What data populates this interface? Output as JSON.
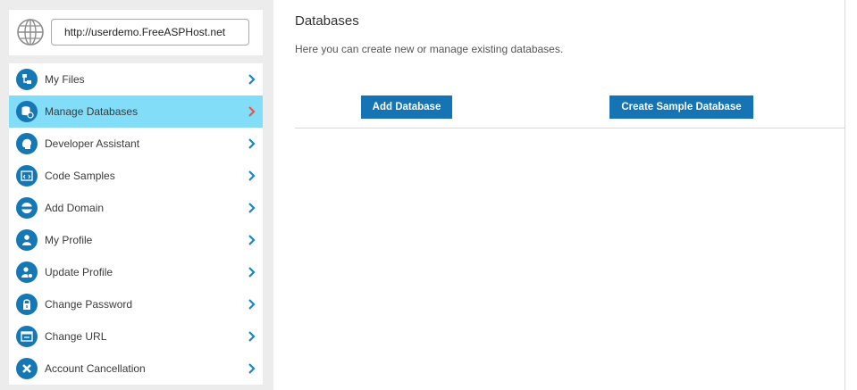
{
  "url": "http://userdemo.FreeASPHost.net",
  "menu": [
    {
      "label": "My Files",
      "icon": "files-icon"
    },
    {
      "label": "Manage Databases",
      "icon": "database-icon"
    },
    {
      "label": "Developer Assistant",
      "icon": "assistant-icon"
    },
    {
      "label": "Code Samples",
      "icon": "code-icon"
    },
    {
      "label": "Add Domain",
      "icon": "www-icon"
    },
    {
      "label": "My Profile",
      "icon": "user-icon"
    },
    {
      "label": "Update Profile",
      "icon": "user-edit-icon"
    },
    {
      "label": "Change Password",
      "icon": "lock-icon"
    },
    {
      "label": "Change URL",
      "icon": "browser-icon"
    },
    {
      "label": "Account Cancellation",
      "icon": "close-icon"
    }
  ],
  "main": {
    "title": "Databases",
    "description": "Here you can create new or manage existing databases.",
    "add_button": "Add Database",
    "sample_button": "Create Sample Database"
  },
  "colors": {
    "accent": "#1774b4",
    "active_row": "#82ddf9",
    "active_chevron": "#e15a4f"
  }
}
